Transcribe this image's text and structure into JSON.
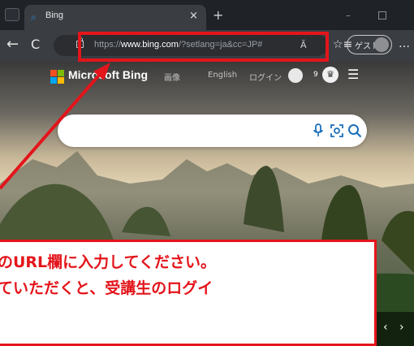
{
  "browser": {
    "tab": {
      "title": "Bing",
      "close_glyph": "×",
      "favicon": "bing-favicon"
    },
    "new_tab_glyph": "+",
    "window_minimize_glyph": "–",
    "toolbar": {
      "back_glyph": "←",
      "refresh_glyph": "C",
      "url_prefix": "https://",
      "url_host": "www.bing.com",
      "url_path": "/?setlang=ja&cc=JP#",
      "read_aloud_label": "Ã",
      "favorites_glyph": "☆≡",
      "profile_label": "ゲスト",
      "more_glyph": "…"
    }
  },
  "bing": {
    "wordmark": "Microsoft Bing",
    "nav_items": [
      "画像",
      "English",
      "ログイン"
    ],
    "points": "9",
    "rewards_glyph": "♛",
    "menu_glyph": "☰",
    "logo_colors": [
      "#f25022",
      "#7fba00",
      "#00a4ef",
      "#ffb900"
    ],
    "search_icon_color": "#1b6fb8"
  },
  "annotation": {
    "line1": "のURL欄に入力してください。",
    "line2": "ていただくと、受講生のログイ",
    "highlight_color": "#e3151b"
  },
  "carousel": {
    "prev_glyph": "‹",
    "next_glyph": "›"
  }
}
